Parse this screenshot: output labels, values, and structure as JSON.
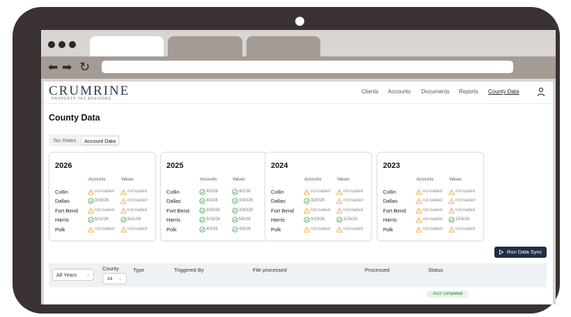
{
  "nav": {
    "links": [
      "Clients",
      "Accounts",
      "Documents",
      "Reports",
      "County Data"
    ],
    "active": "County Data"
  },
  "logo": {
    "main": "CRUMRINE",
    "sub": "PROPERTY TAX ADVISORS"
  },
  "page": {
    "title": "County Data"
  },
  "tabs": {
    "rates": "Tax Rates",
    "account": "Account Data"
  },
  "cards": [
    {
      "year": "2026",
      "headers": [
        "Accounts",
        "Values"
      ],
      "rows": [
        {
          "county": "Collin",
          "accounts": "not loaded",
          "accounts_status": "warn",
          "values": "not loaded",
          "values_status": "warn"
        },
        {
          "county": "Dallas",
          "accounts": "3/16/26",
          "accounts_status": "ok",
          "values": "not loaded",
          "values_status": "warn"
        },
        {
          "county": "Fort Bend",
          "accounts": "not loaded",
          "accounts_status": "warn",
          "values": "not loaded",
          "values_status": "warn"
        },
        {
          "county": "Harris",
          "accounts": "6/11/26",
          "accounts_status": "ok",
          "values": "6/11/26",
          "values_status": "ok"
        },
        {
          "county": "Polk",
          "accounts": "not loaded",
          "accounts_status": "warn",
          "values": "not loaded",
          "values_status": "warn"
        }
      ]
    },
    {
      "year": "2025",
      "headers": [
        "Accounts",
        "Values"
      ],
      "rows": [
        {
          "county": "Collin",
          "accounts": "4/3/26",
          "accounts_status": "ok",
          "values": "4/1/26",
          "values_status": "ok"
        },
        {
          "county": "Dallas",
          "accounts": "4/3/26",
          "accounts_status": "ok",
          "values": "3/30/26",
          "values_status": "ok"
        },
        {
          "county": "Fort Bend",
          "accounts": "3/30/26",
          "accounts_status": "ok",
          "values": "3/30/26",
          "values_status": "ok"
        },
        {
          "county": "Harris",
          "accounts": "5/16/26",
          "accounts_status": "ok",
          "values": "5/6/26",
          "values_status": "ok"
        },
        {
          "county": "Polk",
          "accounts": "4/3/26",
          "accounts_status": "ok",
          "values": "4/3/26",
          "values_status": "ok"
        }
      ]
    },
    {
      "year": "2024",
      "headers": [
        "Accounts",
        "Values"
      ],
      "rows": [
        {
          "county": "Collin",
          "accounts": "not loaded",
          "accounts_status": "warn",
          "values": "not loaded",
          "values_status": "warn"
        },
        {
          "county": "Dallas",
          "accounts": "3/20/26",
          "accounts_status": "ok",
          "values": "not loaded",
          "values_status": "warn"
        },
        {
          "county": "Fort Bend",
          "accounts": "not loaded",
          "accounts_status": "warn",
          "values": "not loaded",
          "values_status": "warn"
        },
        {
          "county": "Harris",
          "accounts": "3/19/26",
          "accounts_status": "ok",
          "values": "2/24/26",
          "values_status": "ok"
        },
        {
          "county": "Polk",
          "accounts": "not loaded",
          "accounts_status": "warn",
          "values": "not loaded",
          "values_status": "warn"
        }
      ]
    },
    {
      "year": "2023",
      "headers": [
        "Accounts",
        "Values"
      ],
      "rows": [
        {
          "county": "Collin",
          "accounts": "not loaded",
          "accounts_status": "warn",
          "values": "not loaded",
          "values_status": "warn"
        },
        {
          "county": "Dallas",
          "accounts": "not loaded",
          "accounts_status": "warn",
          "values": "not loaded",
          "values_status": "warn"
        },
        {
          "county": "Fort Bend",
          "accounts": "not loaded",
          "accounts_status": "warn",
          "values": "not loaded",
          "values_status": "warn"
        },
        {
          "county": "Harris",
          "accounts": "not loaded",
          "accounts_status": "warn",
          "values": "2/24/26",
          "values_status": "ok"
        },
        {
          "county": "Polk",
          "accounts": "not loaded",
          "accounts_status": "warn",
          "values": "not loaded",
          "values_status": "warn"
        }
      ]
    }
  ],
  "actions": {
    "run_sync": "Run Data Sync"
  },
  "table": {
    "year_filter": "All Years",
    "county_label": "County",
    "county_filter": "All",
    "columns": [
      "Type",
      "Triggered By",
      "File processed",
      "Processed",
      "Status"
    ],
    "first_status": "Acct: completed"
  },
  "icons": {
    "back": "arrow-left-icon",
    "forward": "arrow-right-icon",
    "reload": "reload-icon",
    "user": "user-icon",
    "warn": "warning-triangle-icon",
    "ok": "check-circle-icon",
    "play": "play-icon",
    "chevron": "chevron-down-icon"
  },
  "colors": {
    "frame": "#3a3232",
    "brand": "#2e3b4c",
    "warn": "#f0a020",
    "ok": "#2e9e4a",
    "button": "#1f2e44"
  }
}
